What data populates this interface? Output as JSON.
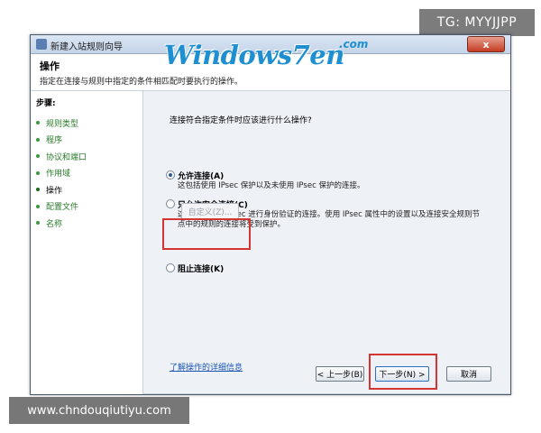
{
  "watermarks": {
    "tg": "TG: MYYJJPP",
    "url": "www.chndouqiutiyu.com"
  },
  "logo": {
    "text": "Windows7en",
    "suffix": ".com"
  },
  "window": {
    "title": "新建入站规则向导",
    "close_label": "x"
  },
  "header": {
    "title": "操作",
    "description": "指定在连接与规则中指定的条件相匹配时要执行的操作。"
  },
  "sidebar": {
    "title": "步骤:",
    "items": [
      {
        "label": "规则类型"
      },
      {
        "label": "程序"
      },
      {
        "label": "协议和端口"
      },
      {
        "label": "作用域"
      },
      {
        "label": "操作"
      },
      {
        "label": "配置文件"
      },
      {
        "label": "名称"
      }
    ]
  },
  "main": {
    "question": "连接符合指定条件时应该进行什么操作?",
    "options": [
      {
        "label": "允许连接(A)",
        "description": "这包括使用 IPsec 保护以及未使用 IPsec 保护的连接。",
        "checked": true
      },
      {
        "label": "只允许安全连接(C)",
        "description": "这仅包括使用 IPsec 进行身份验证的连接。使用 IPsec 属性中的设置以及连接安全规则节点中的规则的连接将受到保护。",
        "checked": false
      },
      {
        "label": "阻止连接(K)",
        "description": "",
        "checked": false
      }
    ],
    "custom_button": "自定义(Z)...",
    "learn_link": "了解操作的详细信息"
  },
  "footer": {
    "back_label": "< 上一步(B)",
    "next_label": "下一步(N) >",
    "cancel_label": "取消"
  },
  "colors": {
    "highlight": "#d43434",
    "sidebar_text": "#2a7a2a",
    "logo_blue": "#1e8fd0"
  }
}
